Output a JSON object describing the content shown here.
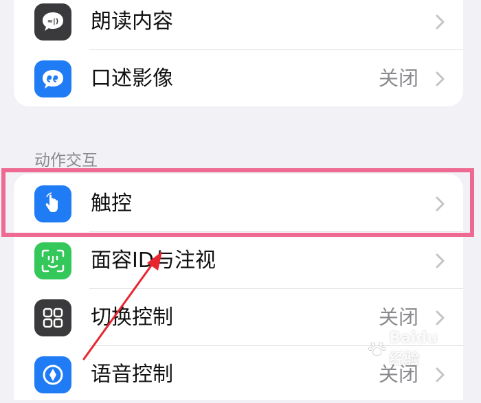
{
  "sections": [
    {
      "header": "",
      "rows": [
        {
          "label": "朗读内容",
          "value": "",
          "icon": "speech-bubble-icon",
          "icon_color": "#3a3a3c"
        },
        {
          "label": "口述影像",
          "value": "关闭",
          "icon": "quote-bubble-icon",
          "icon_color": "#1f7cf5"
        }
      ]
    },
    {
      "header": "动作交互",
      "rows": [
        {
          "label": "触控",
          "value": "",
          "icon": "hand-pointer-icon",
          "icon_color": "#1f7cf5"
        },
        {
          "label": "面容ID与注视",
          "value": "",
          "icon": "face-id-icon",
          "icon_color": "#34c759"
        },
        {
          "label": "切换控制",
          "value": "关闭",
          "icon": "grid-icon",
          "icon_color": "#3a3a3c"
        },
        {
          "label": "语音控制",
          "value": "关闭",
          "icon": "voice-control-icon",
          "icon_color": "#1f7cf5"
        }
      ]
    }
  ],
  "annotation": {
    "highlight_color": "#ee6a92",
    "arrow_color": "#e8262f"
  },
  "watermark": {
    "text": "Baidu 经验"
  }
}
